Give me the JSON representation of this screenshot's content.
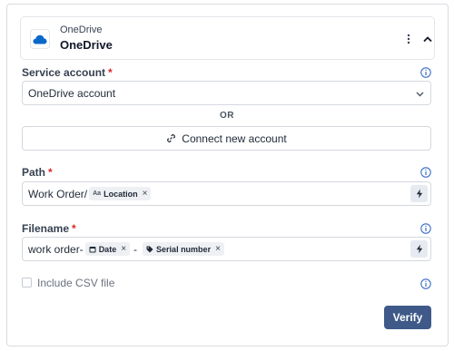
{
  "header": {
    "app_small": "OneDrive",
    "app_big": "OneDrive",
    "logo_icon": "onedrive-cloud-icon",
    "brand_color": "#0a68c8"
  },
  "service_account": {
    "label": "Service account",
    "required": "*",
    "value": "OneDrive account"
  },
  "or_text": "OR",
  "connect": {
    "label": "Connect new account",
    "icon": "link-icon"
  },
  "path": {
    "label": "Path",
    "required": "*",
    "prefix": "Work Order/",
    "chip": {
      "type_marker": "Aa",
      "label": "Location",
      "remove": "×"
    }
  },
  "filename": {
    "label": "Filename",
    "required": "*",
    "prefix": "work order-",
    "chip1": {
      "icon": "calendar-icon",
      "label": "Date",
      "remove": "×"
    },
    "separator": "-",
    "chip2": {
      "icon": "tag-icon",
      "label": "Serial number",
      "remove": "×"
    }
  },
  "include_csv": {
    "label": "Include CSV file",
    "checked": false
  },
  "verify": {
    "label": "Verify",
    "color": "#3f5a88"
  },
  "accent": {
    "info_icon_color": "#3b6fc4",
    "required_color": "#dc2626"
  }
}
